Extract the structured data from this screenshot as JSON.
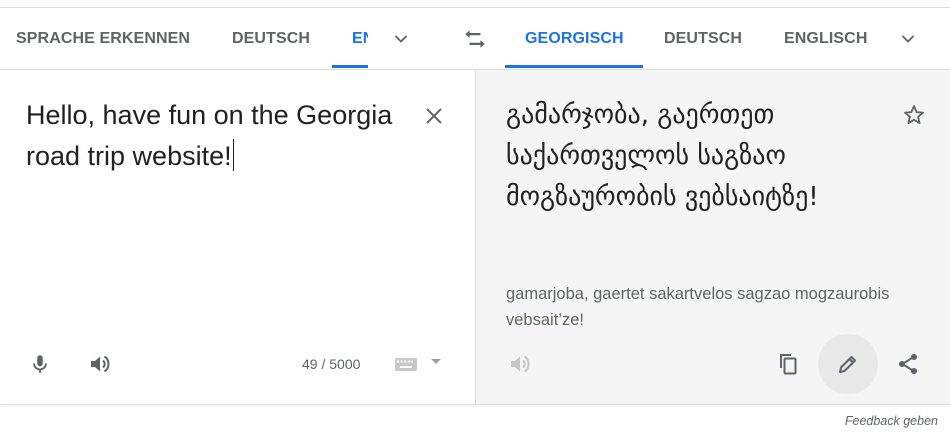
{
  "source_tabs": [
    {
      "label": "SPRACHE ERKENNEN",
      "active": false
    },
    {
      "label": "DEUTSCH",
      "active": false
    },
    {
      "label": "EN",
      "active": true
    }
  ],
  "target_tabs": [
    {
      "label": "GEORGISCH",
      "active": true
    },
    {
      "label": "DEUTSCH",
      "active": false
    },
    {
      "label": "ENGLISCH",
      "active": false
    }
  ],
  "source": {
    "text": "Hello, have fun on the Georgia road trip website!",
    "char_count": "49 / 5000"
  },
  "target": {
    "text": "გამარჯობა, გაერთეთ საქართველოს საგზაო მოგზაურობის ვებსაიტზე!",
    "transliteration": "gamarjoba, gaertet sakartvelos sagzao mogzaurobis vebsait’ze!"
  },
  "footer": {
    "feedback_label": "Feedback geben"
  },
  "colors": {
    "accent": "#1a73e8",
    "tab_text": "#5f6368",
    "target_bg": "#f5f5f5"
  },
  "icons": {
    "source_dropdown": "chevron-down-icon",
    "swap": "swap-icon",
    "target_dropdown": "chevron-down-icon",
    "clear": "close-icon",
    "star": "star-outline-icon",
    "mic": "microphone-icon",
    "listen_source": "speaker-icon",
    "keyboard": "keyboard-icon",
    "listen_target": "speaker-icon",
    "copy": "copy-icon",
    "edit": "pencil-icon",
    "share": "share-icon"
  }
}
